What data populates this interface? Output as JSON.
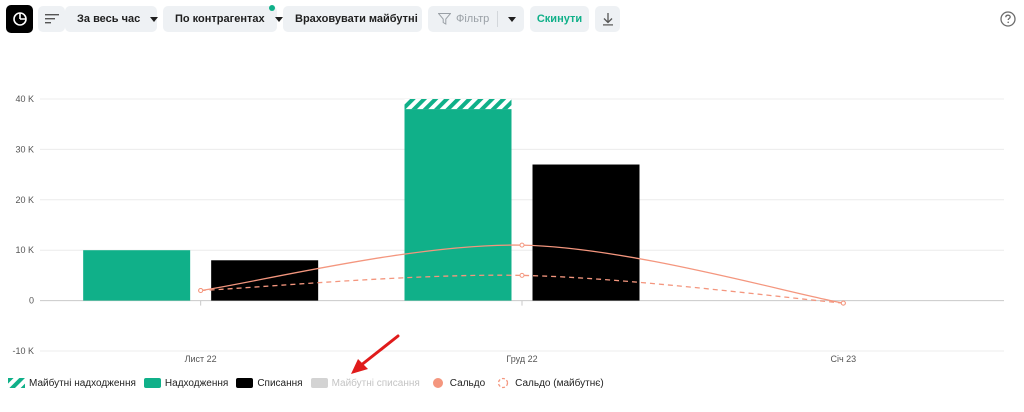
{
  "toolbar": {
    "period_label": "За весь час",
    "group_label": "По контрагентах",
    "future_label": "Враховувати майбутні",
    "filter_label": "Фільтр",
    "reset_label": "Скинути",
    "icons": [
      "logo-icon",
      "menu-lines-icon",
      "filter-icon",
      "download-icon",
      "help-icon"
    ]
  },
  "colors": {
    "income": "#10b089",
    "expense": "#000000",
    "future_expense": "#cfcfcf",
    "balance": "#f4967e",
    "accent": "#10b089"
  },
  "chart_data": {
    "type": "bar",
    "categories": [
      "Лист 22",
      "Груд 22",
      "Січ 23"
    ],
    "ylim": [
      -10000,
      40000
    ],
    "yticks": [
      {
        "value": 40000,
        "label": "40 K"
      },
      {
        "value": 30000,
        "label": "30 K"
      },
      {
        "value": 20000,
        "label": "20 K"
      },
      {
        "value": 10000,
        "label": "10 K"
      },
      {
        "value": 0,
        "label": "0"
      },
      {
        "value": -10000,
        "label": "-10 K"
      }
    ],
    "grid": true,
    "series": [
      {
        "name": "Майбутні надходження",
        "kind": "bar-stack-top",
        "values": [
          0,
          2000,
          0
        ]
      },
      {
        "name": "Надходження",
        "kind": "bar",
        "values": [
          10000,
          38000,
          0
        ]
      },
      {
        "name": "Списання",
        "kind": "bar",
        "values": [
          8000,
          27000,
          0
        ]
      },
      {
        "name": "Майбутні списання",
        "kind": "bar",
        "values": [
          0,
          0,
          0
        ],
        "disabled": true
      },
      {
        "name": "Сальдо",
        "kind": "line",
        "values": [
          2000,
          11000,
          -500
        ]
      },
      {
        "name": "Сальдо (майбутнє)",
        "kind": "line-dashed",
        "values": [
          2000,
          5000,
          -500
        ]
      }
    ]
  }
}
